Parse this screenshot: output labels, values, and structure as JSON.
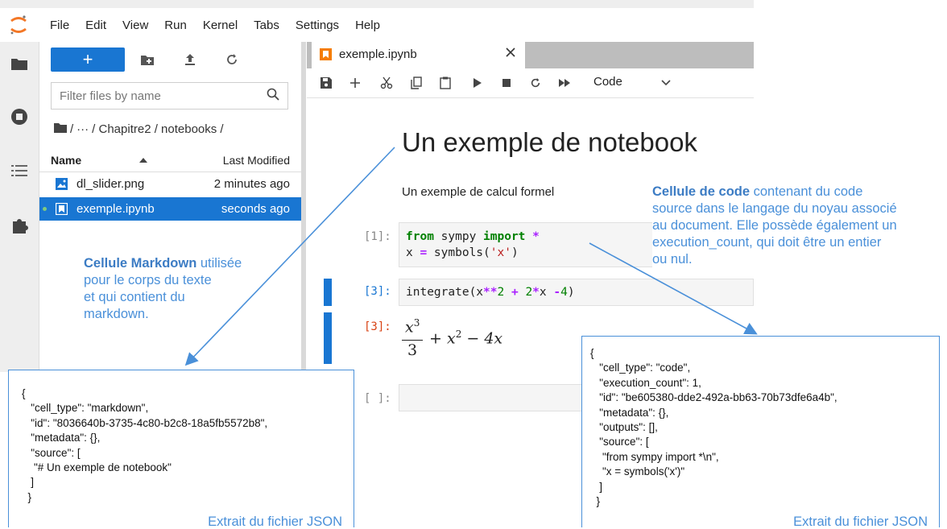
{
  "menubar": {
    "items": [
      "File",
      "Edit",
      "View",
      "Run",
      "Kernel",
      "Tabs",
      "Settings",
      "Help"
    ]
  },
  "activity_icons": [
    "folder-icon",
    "stop-circle-icon",
    "list-icon",
    "puzzle-icon"
  ],
  "filebrowser": {
    "new_label": "+",
    "filter_placeholder": "Filter files by name",
    "breadcrumb": {
      "ellipsis": "···",
      "path": "/ Chapitre2 / notebooks /",
      "sep": "/"
    },
    "columns": {
      "name": "Name",
      "modified": "Last Modified"
    },
    "files": [
      {
        "name": "dl_slider.png",
        "modified": "2 minutes ago"
      },
      {
        "name": "exemple.ipynb",
        "modified": "seconds ago"
      }
    ]
  },
  "notebook": {
    "tab_title": "exemple.ipynb",
    "cell_type_select": "Code",
    "heading": "Un exemple de notebook",
    "paragraph": "Un exemple de calcul formel",
    "cells": {
      "c1_prompt": "[1]:",
      "c1_line1": {
        "kw1": "from",
        "mod": " sympy ",
        "kw2": "import",
        "star": " *"
      },
      "c1_line2": {
        "a": "x ",
        "eq": "=",
        "b": " symbols(",
        "s": "'x'",
        "c": ")"
      },
      "c2_prompt": "[3]:",
      "c2_code": {
        "a": "integrate(x",
        "p": "**",
        "two": "2",
        "sp": " ",
        "plus": "+",
        "sp2": " ",
        "two2": "2",
        "mul": "*",
        "x": "x ",
        "m": "-",
        "four": "4",
        "close": ")"
      },
      "out_prompt": "[3]:",
      "math": {
        "num": "x",
        "exp": "3",
        "den": "3",
        "rest1": "+ x",
        "exp2": "2",
        "rest2": "− 4x"
      },
      "empty_prompt": "[ ]:"
    }
  },
  "annotations": {
    "markdown": {
      "bold": "Cellule Markdown",
      "lines": [
        " utilisée",
        "pour le corps du texte",
        "et qui contient du",
        "markdown."
      ]
    },
    "code": {
      "bold": "Cellule de code",
      "lines": [
        " contenant du code",
        "source dans le langage du noyau associé",
        "au document. Elle possède également un",
        "execution_count, qui doit être un entier",
        "ou nul."
      ]
    }
  },
  "json_left": {
    "lines": [
      "{",
      "   \"cell_type\": \"markdown\",",
      "   \"id\": \"8036640b-3735-4c80-b2c8-18a5fb5572b8\",",
      "   \"metadata\": {},",
      "   \"source\": [",
      "    \"# Un exemple de notebook\"",
      "   ]",
      "  }"
    ],
    "caption": "Extrait du fichier JSON"
  },
  "json_right": {
    "lines": [
      "{",
      "   \"cell_type\": \"code\",",
      "   \"execution_count\": 1,",
      "   \"id\": \"be605380-dde2-492a-bb63-70b73dfe6a4b\",",
      "   \"metadata\": {},",
      "   \"outputs\": [],",
      "   \"source\": [",
      "    \"from sympy import *\\n\",",
      "    \"x = symbols('x')\"",
      "   ]",
      "  }"
    ],
    "caption": "Extrait du fichier JSON"
  },
  "colors": {
    "accent": "#1976d2",
    "annotation": "#4a90d9",
    "orange": "#f57c00"
  }
}
